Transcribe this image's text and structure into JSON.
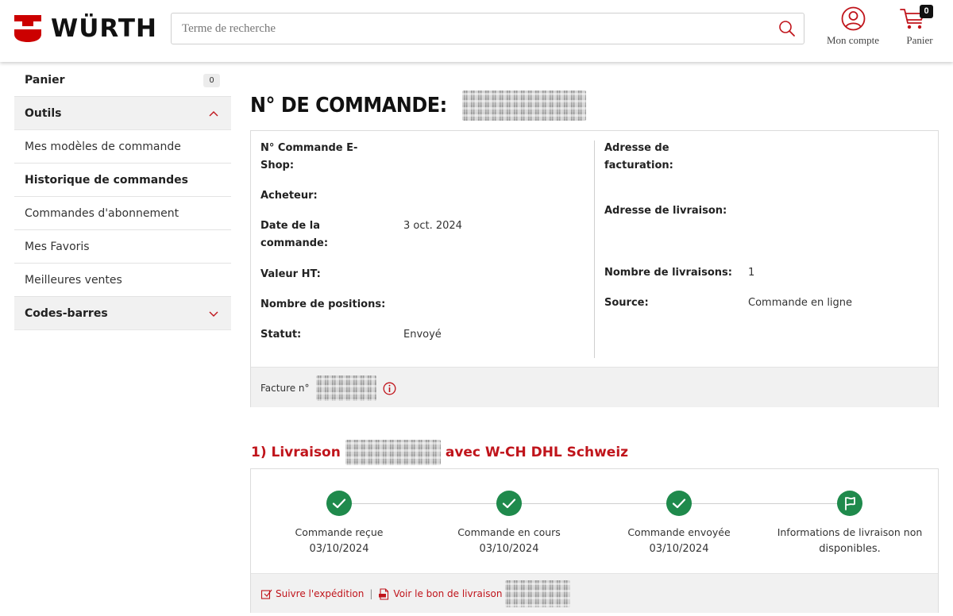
{
  "header": {
    "logo_text": "WÜRTH",
    "search_placeholder": "Terme de recherche",
    "account_label": "Mon compte",
    "cart_label": "Panier",
    "cart_count": "0"
  },
  "sidebar": {
    "panier_label": "Panier",
    "panier_count": "0",
    "outils_label": "Outils",
    "items": [
      {
        "label": "Mes modèles de commande"
      },
      {
        "label": "Historique de commandes"
      },
      {
        "label": "Commandes d'abonnement"
      },
      {
        "label": "Mes Favoris"
      },
      {
        "label": "Meilleures ventes"
      }
    ],
    "codes_label": "Codes-barres"
  },
  "order": {
    "title": "N° DE COMMANDE:",
    "labels": {
      "eshop": "N° Commande E-",
      "eshop2": "Shop:",
      "buyer": "Acheteur:",
      "date": "Date de la",
      "date2": "commande:",
      "value": "Valeur HT:",
      "positions": "Nombre de positions:",
      "status": "Statut:",
      "billing": "Adresse de",
      "billing2": "facturation:",
      "shipping": "Adresse de livraison:",
      "deliveries": "Nombre de livraisons:",
      "source": "Source:"
    },
    "values": {
      "date": "3 oct. 2024",
      "status": "Envoyé",
      "deliveries": "1",
      "source": "Commande en ligne"
    },
    "invoice_label": "Facture n°"
  },
  "delivery": {
    "title_prefix": "1) Livraison",
    "title_suffix": "avec W-CH DHL Schweiz",
    "steps": [
      {
        "label": "Commande reçue",
        "date": "03/10/2024",
        "icon": "check-icon"
      },
      {
        "label": "Commande en cours",
        "date": "03/10/2024",
        "icon": "check-icon"
      },
      {
        "label": "Commande envoyée",
        "date": "03/10/2024",
        "icon": "check-icon"
      },
      {
        "label": "Informations de livraison non",
        "date": "disponibles.",
        "icon": "flag-icon"
      }
    ],
    "track_link": "Suivre l'expédition",
    "note_link": "Voir le bon de livraison"
  },
  "colors": {
    "accent_red": "#c0141b",
    "success_green": "#1f8a4c"
  }
}
